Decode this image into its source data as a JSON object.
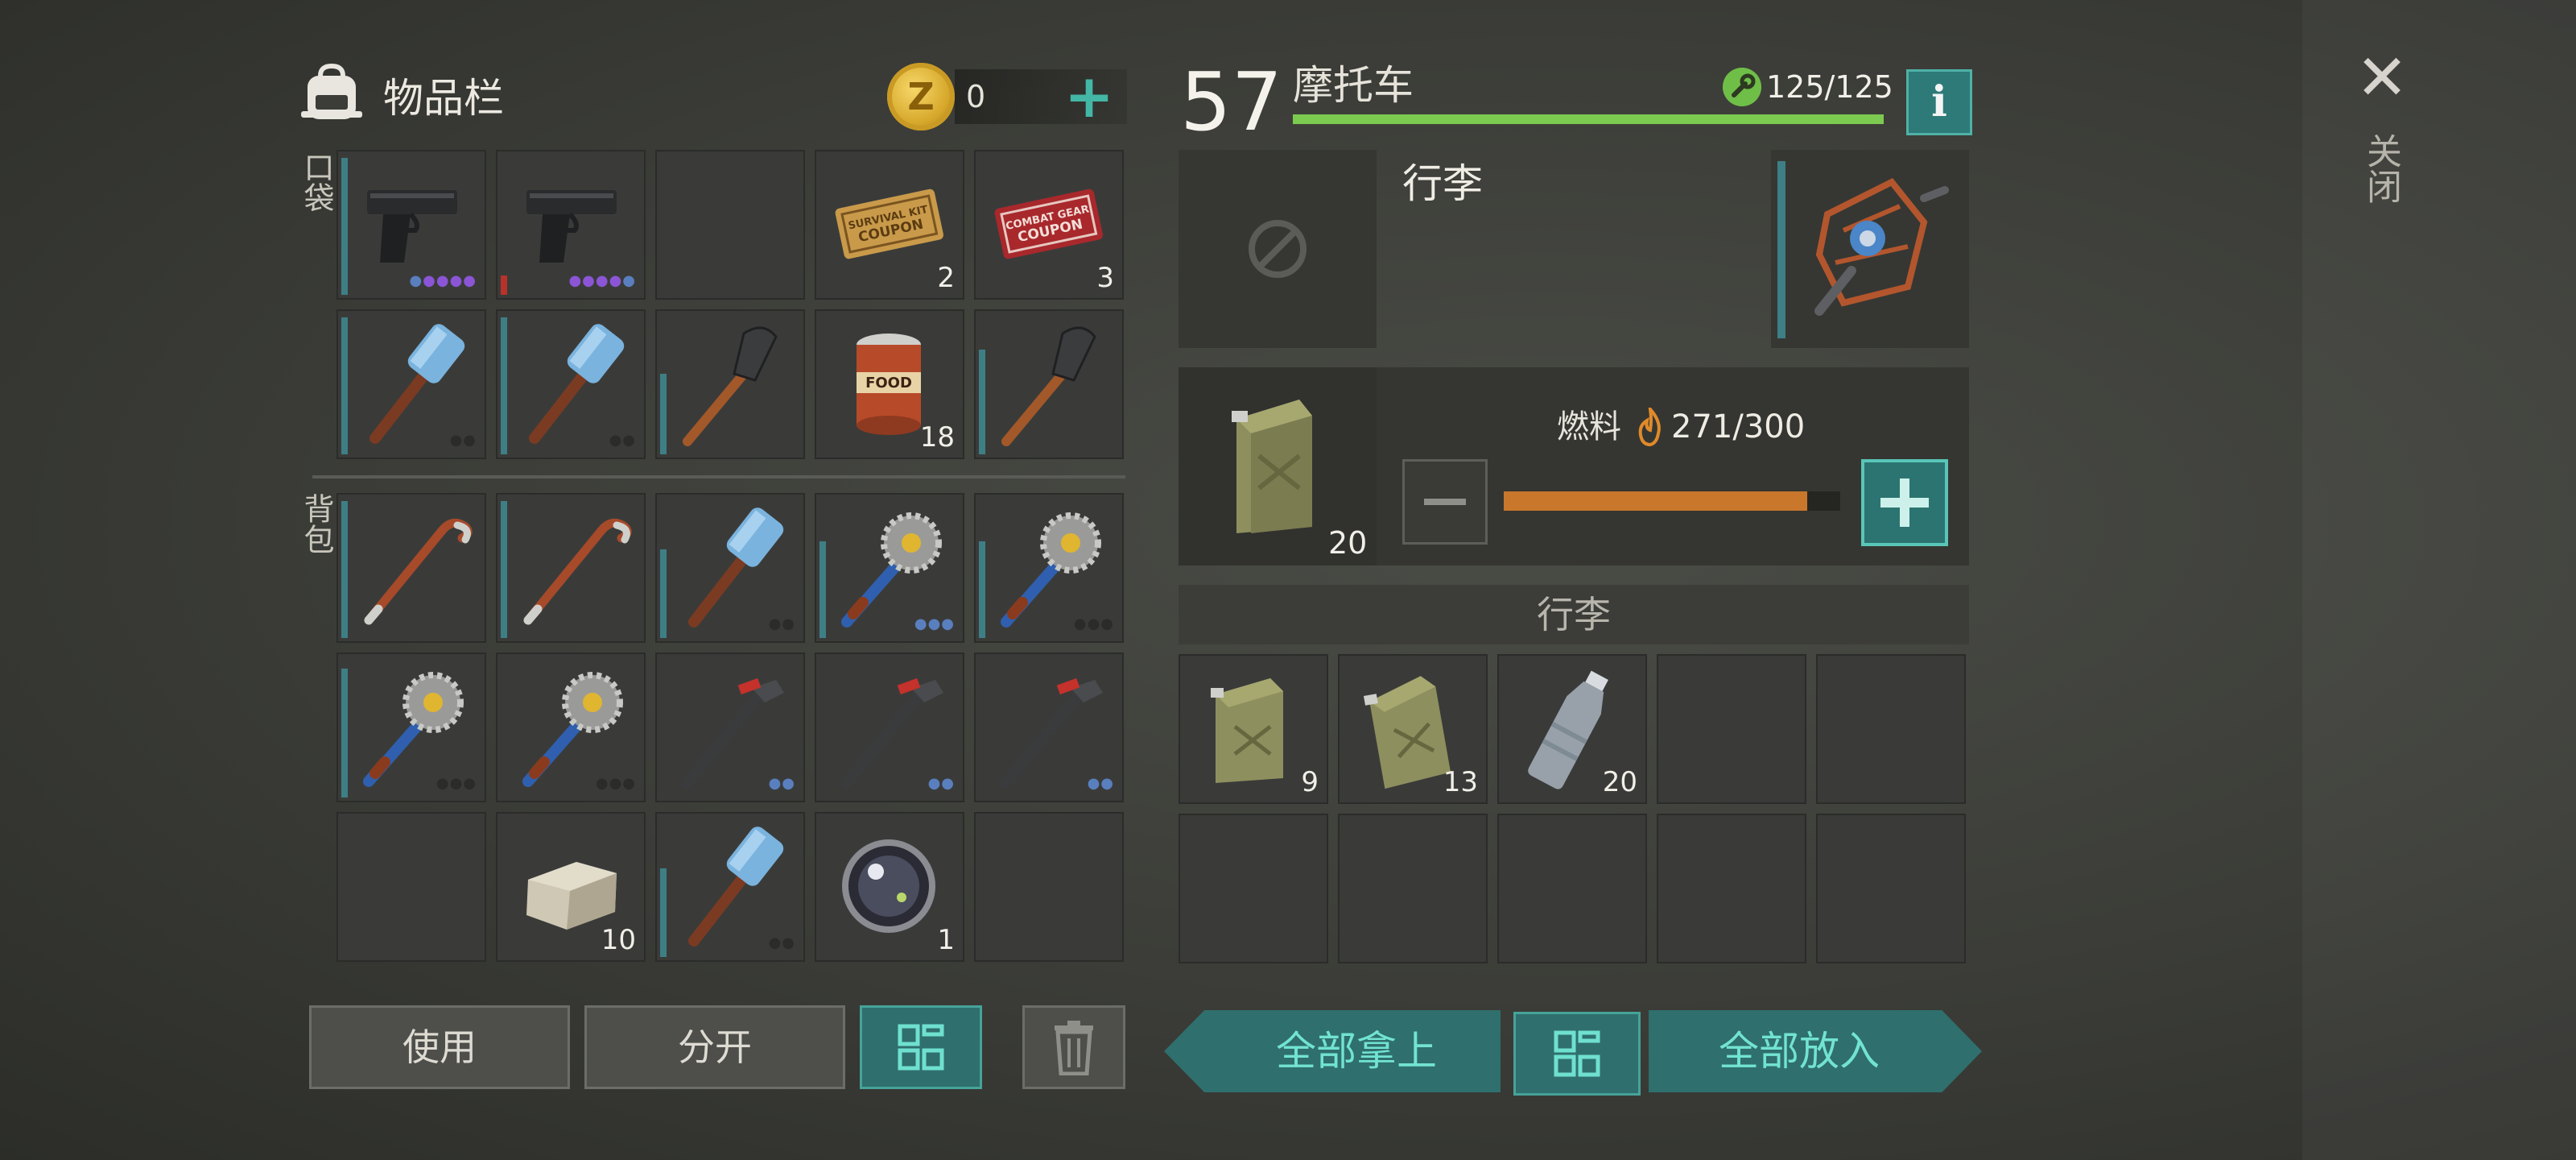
{
  "header": {
    "inventory_title": "物品栏",
    "coin_symbol": "Z",
    "coin_count": "0",
    "coin_add": "+",
    "close_label": "关闭",
    "close_symbol": "✕"
  },
  "sections": {
    "pockets": "口袋",
    "backpack": "背包"
  },
  "slots": {
    "p1": {
      "icon": "pistol-icon",
      "dots": "●●●●"
    },
    "p2": {
      "icon": "pistol-icon",
      "dots": "●●●●"
    },
    "p3": {
      "icon": "empty"
    },
    "p4": {
      "icon": "survival-kit-coupon-icon",
      "count": "2",
      "text": "SURVIVAL KIT COUPON"
    },
    "p5": {
      "icon": "combat-gear-coupon-icon",
      "count": "3",
      "text": "COMBAT GEAR COUPON"
    },
    "p6": {
      "icon": "sledgehammer-icon",
      "dots": "●●"
    },
    "p7": {
      "icon": "sledgehammer-icon",
      "dots": "●●"
    },
    "p8": {
      "icon": "shovel-icon"
    },
    "p9": {
      "icon": "canned-food-icon",
      "count": "18",
      "text": "FOOD"
    },
    "p10": {
      "icon": "shovel-icon"
    },
    "b1": {
      "icon": "crowbar-icon"
    },
    "b2": {
      "icon": "crowbar-icon"
    },
    "b3": {
      "icon": "sledgehammer-icon",
      "dots": "●●"
    },
    "b4": {
      "icon": "saw-mace-icon",
      "dots": "●●●"
    },
    "b5": {
      "icon": "saw-mace-icon",
      "dots": "●●●"
    },
    "b6": {
      "icon": "saw-mace-icon",
      "dots": "●●●"
    },
    "b7": {
      "icon": "saw-mace-icon",
      "dots": "●●●"
    },
    "b8": {
      "icon": "pipe-wrench-icon",
      "dots": "●●"
    },
    "b9": {
      "icon": "pipe-wrench-icon",
      "dots": "●●"
    },
    "b10": {
      "icon": "pipe-wrench-icon",
      "dots": "●●"
    },
    "b11": {
      "icon": "empty"
    },
    "b12": {
      "icon": "stone-icon",
      "count": "10"
    },
    "b13": {
      "icon": "sledgehammer-icon",
      "dots": "●●"
    },
    "b14": {
      "icon": "lens-icon",
      "count": "1"
    },
    "b15": {
      "icon": "empty"
    }
  },
  "actions": {
    "use": "使用",
    "split": "分开",
    "sort_icon": "grid-icon",
    "delete_icon": "trash-icon"
  },
  "vehicle": {
    "level": "57",
    "name": "摩托车",
    "condition": "125/125",
    "condition_fraction": 1.0,
    "info": "i",
    "slot_title": "行李",
    "fuel_label": "燃料",
    "fuel_value": "271/300",
    "fuel_fraction": 0.903,
    "fuel_can_count": "20",
    "cargo_header": "行李",
    "cargo": [
      {
        "icon": "jerry-can-icon",
        "count": "9"
      },
      {
        "icon": "jerry-can-icon",
        "count": "13"
      },
      {
        "icon": "water-bottle-icon",
        "count": "20"
      }
    ]
  },
  "transfer": {
    "take_all": "全部拿上",
    "put_all": "全部放入",
    "sort_icon": "grid-icon"
  },
  "colors": {
    "accent": "#2f6f6d",
    "accent_text": "#72e3d2",
    "health_bar": "#7ccb50",
    "fuel_bar": "#c9772b",
    "durability": "#3e7f85",
    "purple_dot": "#8b55d6",
    "blue_dot": "#5a7fbf",
    "gray_dot": "#2b2b29"
  }
}
